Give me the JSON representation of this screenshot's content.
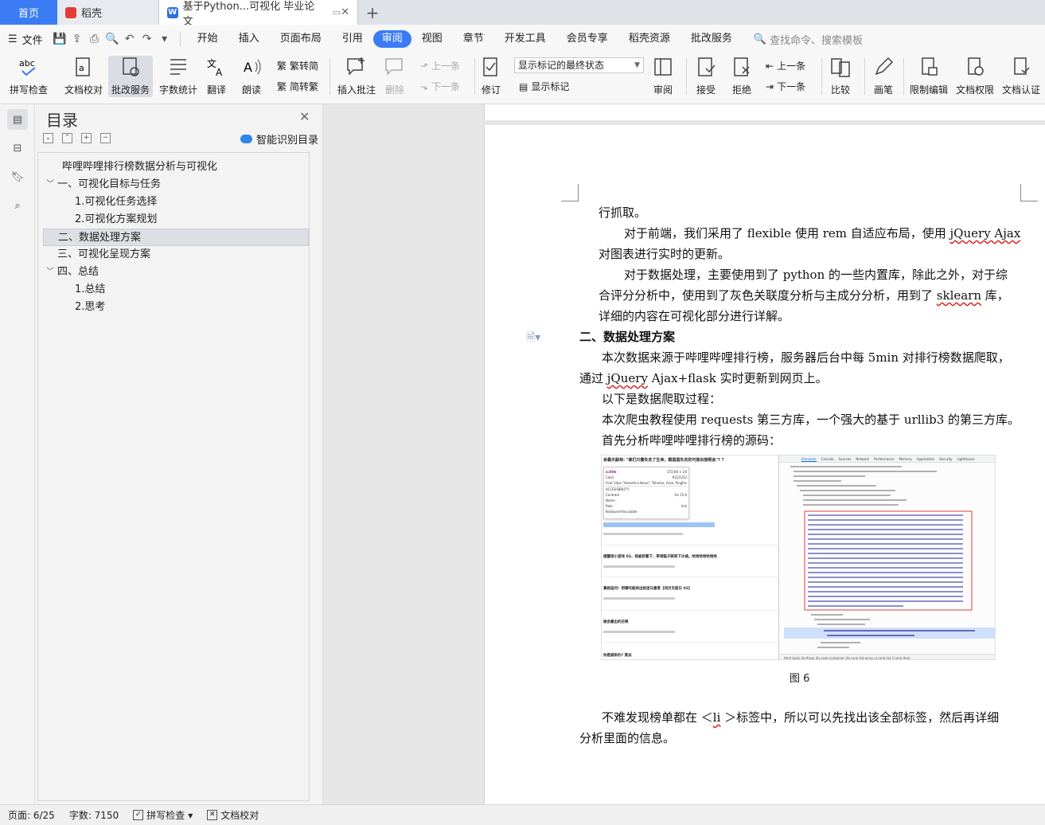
{
  "tabs": {
    "home": "首页",
    "docer": "稻壳",
    "doc": "基于Python...可视化 毕业论文",
    "add": "+"
  },
  "menu": {
    "file": "文件",
    "items": [
      "开始",
      "插入",
      "页面布局",
      "引用",
      "审阅",
      "视图",
      "章节",
      "开发工具",
      "会员专享",
      "稻壳资源",
      "批改服务"
    ],
    "active": "审阅",
    "search": "查找命令、搜索模板"
  },
  "ribbon": {
    "spell_check": "拼写检查",
    "doc_proof": "文档校对",
    "correction_service": "批改服务",
    "word_count": "字数统计",
    "translate": "翻译",
    "read_aloud": "朗读",
    "to_simplified": "繁转简",
    "to_traditional": "简转繁",
    "insert_comment": "插入批注",
    "delete": "删除",
    "prev_comment": "上一条",
    "next_comment": "下一条",
    "track_changes": "修订",
    "markup_state": "显示标记的最终状态",
    "show_markup": "显示标记",
    "review": "审阅",
    "accept": "接受",
    "reject": "拒绝",
    "prev_change": "上一条",
    "next_change": "下一条",
    "compare": "比较",
    "pen": "画笔",
    "restrict_edit": "限制编辑",
    "doc_permission": "文档权限",
    "doc_certify": "文档认证"
  },
  "toc": {
    "title": "目录",
    "smart_recognize": "智能识别目录",
    "items": [
      {
        "label": "哔哩哔哩排行榜数据分析与可视化",
        "level": 0
      },
      {
        "label": "一、可视化目标与任务",
        "level": 1,
        "expanded": true
      },
      {
        "label": "1.可视化任务选择",
        "level": 2
      },
      {
        "label": "2.可视化方案规划",
        "level": 2
      },
      {
        "label": "二、数据处理方案",
        "level": 1,
        "selected": true
      },
      {
        "label": "三、可视化呈现方案",
        "level": 1
      },
      {
        "label": "四、总结",
        "level": 1,
        "expanded": true
      },
      {
        "label": "1.总结",
        "level": 2
      },
      {
        "label": "2.思考",
        "level": 2
      }
    ]
  },
  "document": {
    "line1": "行抓取。",
    "p1a": "对于前端，我们采用了 flexible 使用 rem 自适应布局，使用 ",
    "p1b": "jQuery Ajax",
    "p1c": "对图表进行实时的更新。",
    "p2a": "对于数据处理，主要使用到了 python 的一些内置库，除此之外，对于综",
    "p2b": "合评分分析中，使用到了灰色关联度分析与主成分分析，用到了 ",
    "p2c": "sklearn",
    "p2d": " 库，",
    "p2e": "详细的内容在可视化部分进行详解。",
    "heading": "二、数据处理方案",
    "p3a": "本次数据来源于哔哩哔哩排行榜，服务器后台中每 5min 对排行榜数据爬取，",
    "p3b": "通过 ",
    "p3c": "jQuery",
    "p3d": " Ajax+flask 实时更新到网页上。",
    "p4": "以下是数据爬取过程：",
    "p5": "本次爬虫教程使用 requests 第三方库，一个强大的基于 urllib3 的第三方库。",
    "p6": "首先分析哔哩哔哩排行榜的源码：",
    "caption": "图 6",
    "p7a": "不难发现榜单都在 ＜",
    "p7b": "li",
    "p7c": " ＞标签中，所以可以先找出该全部标签，然后再详细",
    "p7d": "分析里面的信息。"
  },
  "figure": {
    "left_title": "余暴天敲林: \"谁们只撒失去了生命，模眉眉失去的可接出接照会\"? ?",
    "tooltip_tag": "a.title",
    "tooltip_size": "372.66 × 20",
    "tooltip_color_label": "Color",
    "tooltip_color": "#222222",
    "tooltip_font": "Font   14px \"Helvetica Neue\", Tahoma, Arial, PingFang SC",
    "tooltip_access": "ACCESSIBILITY",
    "tooltip_contrast": "Contrast",
    "tooltip_contrast_val": "Aa  15.6",
    "tooltip_name": "Name",
    "tooltip_role": "Role",
    "tooltip_role_val": "link",
    "tooltip_keyboard": "Keyboard-focusable",
    "items": [
      "提醒球小游戏 03，掠被抓看下，带领猫子跌铁下沙城。哈哈哈哈哈哈哈",
      "真相追问！用哪吒般将出结违马意麦【闭月无敌日 02】",
      "做会最出的召唤",
      "你是越来约? 莫派"
    ],
    "devtools_tabs": [
      "Elements",
      "Console",
      "Sources",
      "Network",
      "Performance",
      "Memory",
      "Application",
      "Security",
      "Lighthouse"
    ],
    "breadcrumb": "html  body  div#app  div.rank-container  div.rank-list-wrap  ul.rank-list  li.rank-item"
  },
  "status": {
    "page": "页面: 6/25",
    "words": "字数: 7150",
    "spell": "拼写检查",
    "proof": "文档校对"
  },
  "colors": {
    "accent": "#3b7cf4",
    "highlight_box": "#e23b3b"
  }
}
